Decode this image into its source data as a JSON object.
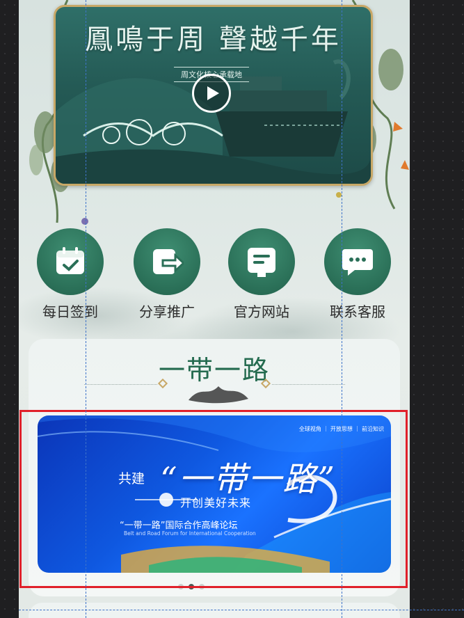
{
  "video": {
    "title": "鳳鳴于周 聲越千年",
    "subtitle": "周文化核心承载地"
  },
  "quick_actions": [
    {
      "label": "每日签到",
      "icon": "calendar-check-icon"
    },
    {
      "label": "分享推广",
      "icon": "share-arrow-icon"
    },
    {
      "label": "官方网站",
      "icon": "website-doc-icon"
    },
    {
      "label": "联系客服",
      "icon": "chat-bubble-icon"
    }
  ],
  "section": {
    "title": "一带一路"
  },
  "banner": {
    "top_tags": "全球视角 ｜ 开放思想 ｜ 前沿知识",
    "prefix": "共建",
    "headline": "“一带一路”",
    "tagline": "开创美好未来",
    "forum": "“一带一路”国际合作高峰论坛",
    "forum_en": "Belt and Road Forum for International Cooperation",
    "active_slide": 2,
    "total_slides": 3
  },
  "colors": {
    "accent_green": "#2a6f57",
    "highlight_red": "#e0202a",
    "frame_gold": "#c8a867",
    "banner_blue": "#0f58e0"
  }
}
